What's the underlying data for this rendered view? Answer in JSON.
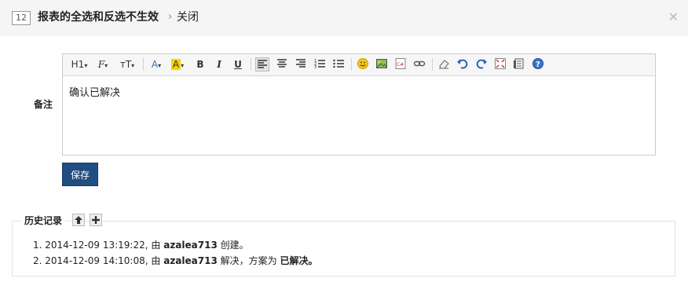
{
  "header": {
    "id": "12",
    "title": "报表的全选和反选不生效",
    "separator": "›",
    "action": "关闭",
    "close_icon": "close-icon"
  },
  "form": {
    "remark_label": "备注",
    "editor_content": "确认已解决",
    "save_label": "保存"
  },
  "toolbar": {
    "heading": "H1",
    "font_family": "F",
    "font_size": "тT"
  },
  "history": {
    "title": "历史记录",
    "entries": [
      {
        "num": "1.",
        "time": "2014-12-09 13:19:22,",
        "by": "由",
        "user": "azalea713",
        "action": "创建。"
      },
      {
        "num": "2.",
        "time": "2014-12-09 14:10:08,",
        "by": "由",
        "user": "azalea713",
        "action": "解决，方案为",
        "result": "已解决。"
      }
    ]
  },
  "colors": {
    "primary_button": "#1f4e82",
    "header_bg": "#f5f5f5"
  }
}
